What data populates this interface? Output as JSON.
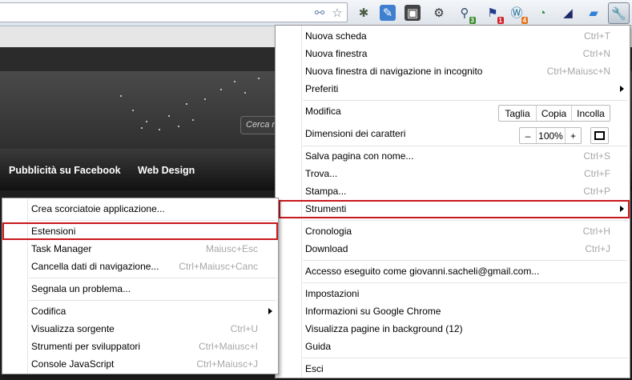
{
  "toolbar": {
    "omnibox_value": "",
    "icons": [
      "link-icon",
      "star-icon",
      "bug-icon",
      "puzzle-icon",
      "evernote-icon",
      "gear-icon",
      "magnifier-icon",
      "flag-icon",
      "wordpress-icon",
      "timer-icon",
      "gauge-icon",
      "note-icon",
      "wrench-icon"
    ],
    "badges": {
      "magnifier": "3",
      "flag": "1",
      "wordpress": "4"
    }
  },
  "page": {
    "search_placeholder": "Cerca n",
    "nav": [
      "Pubblicità su Facebook",
      "Web Design"
    ]
  },
  "main_menu": {
    "new_tab": {
      "label": "Nuova scheda",
      "shortcut": "Ctrl+T"
    },
    "new_window": {
      "label": "Nuova finestra",
      "shortcut": "Ctrl+N"
    },
    "incognito": {
      "label": "Nuova finestra di navigazione in incognito",
      "shortcut": "Ctrl+Maiusc+N"
    },
    "bookmarks": {
      "label": "Preferiti"
    },
    "edit": {
      "label": "Modifica",
      "cut": "Taglia",
      "copy": "Copia",
      "paste": "Incolla"
    },
    "zoom": {
      "label": "Dimensioni dei caratteri",
      "minus": "–",
      "value": "100%",
      "plus": "+"
    },
    "save_page": {
      "label": "Salva pagina con nome...",
      "shortcut": "Ctrl+S"
    },
    "find": {
      "label": "Trova...",
      "shortcut": "Ctrl+F"
    },
    "print": {
      "label": "Stampa...",
      "shortcut": "Ctrl+P"
    },
    "tools": {
      "label": "Strumenti"
    },
    "history": {
      "label": "Cronologia",
      "shortcut": "Ctrl+H"
    },
    "downloads": {
      "label": "Download",
      "shortcut": "Ctrl+J"
    },
    "signed_in": {
      "label": "Accesso eseguito come giovanni.sacheli@gmail.com..."
    },
    "settings": {
      "label": "Impostazioni"
    },
    "about": {
      "label": "Informazioni su Google Chrome"
    },
    "background_pages": {
      "label": "Visualizza pagine in background (12)"
    },
    "help": {
      "label": "Guida"
    },
    "exit": {
      "label": "Esci"
    }
  },
  "sub_menu": {
    "create_shortcuts": {
      "label": "Crea scorciatoie applicazione..."
    },
    "extensions": {
      "label": "Estensioni"
    },
    "task_manager": {
      "label": "Task Manager",
      "shortcut": "Maiusc+Esc"
    },
    "clear_data": {
      "label": "Cancella dati di navigazione...",
      "shortcut": "Ctrl+Maiusc+Canc"
    },
    "report_issue": {
      "label": "Segnala un problema..."
    },
    "encoding": {
      "label": "Codifica"
    },
    "view_source": {
      "label": "Visualizza sorgente",
      "shortcut": "Ctrl+U"
    },
    "dev_tools": {
      "label": "Strumenti per sviluppatori",
      "shortcut": "Ctrl+Maiusc+I"
    },
    "js_console": {
      "label": "Console JavaScript",
      "shortcut": "Ctrl+Maiusc+J"
    }
  },
  "colors": {
    "highlight": "#c8181d",
    "menu_border": "#979797",
    "shortcut_text": "#a7a7a7"
  }
}
